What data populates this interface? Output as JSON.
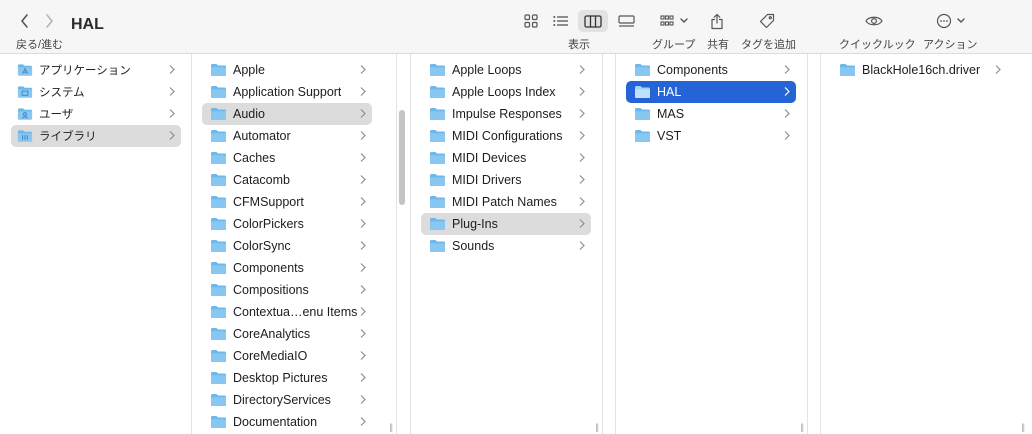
{
  "window": {
    "title": "HAL",
    "nav_label": "戻る/進む"
  },
  "toolbar": {
    "view_label": "表示",
    "group_label": "グループ",
    "share_label": "共有",
    "tag_label": "タグを追加",
    "quicklook_label": "クイックルック",
    "action_label": "アクション"
  },
  "sidebar": {
    "items": [
      {
        "label": "アプリケーション",
        "icon": "applications-folder-icon"
      },
      {
        "label": "システム",
        "icon": "system-folder-icon"
      },
      {
        "label": "ユーザ",
        "icon": "users-folder-icon"
      },
      {
        "label": "ライブラリ",
        "icon": "library-folder-icon",
        "selected": true
      }
    ]
  },
  "columns": [
    {
      "name": "library",
      "items": [
        "Apple",
        "Application Support",
        "Audio",
        "Automator",
        "Caches",
        "Catacomb",
        "CFMSupport",
        "ColorPickers",
        "ColorSync",
        "Components",
        "Compositions",
        "Contextua…enu Items",
        "CoreAnalytics",
        "CoreMediaIO",
        "Desktop Pictures",
        "DirectoryServices",
        "Documentation"
      ],
      "selected_index": 2,
      "selection": "gray"
    },
    {
      "name": "audio",
      "items": [
        "Apple Loops",
        "Apple Loops Index",
        "Impulse Responses",
        "MIDI Configurations",
        "MIDI Devices",
        "MIDI Drivers",
        "MIDI Patch Names",
        "Plug-Ins",
        "Sounds"
      ],
      "selected_index": 7,
      "selection": "gray"
    },
    {
      "name": "plugins",
      "items": [
        "Components",
        "HAL",
        "MAS",
        "VST"
      ],
      "selected_index": 1,
      "selection": "blue"
    },
    {
      "name": "hal",
      "items": [
        "BlackHole16ch.driver"
      ],
      "selected_index": -1,
      "selection": "none"
    }
  ],
  "colors": {
    "folder": "#6cb7ec",
    "selection_blue": "#2464d6",
    "selection_gray": "#dcdcdc"
  }
}
